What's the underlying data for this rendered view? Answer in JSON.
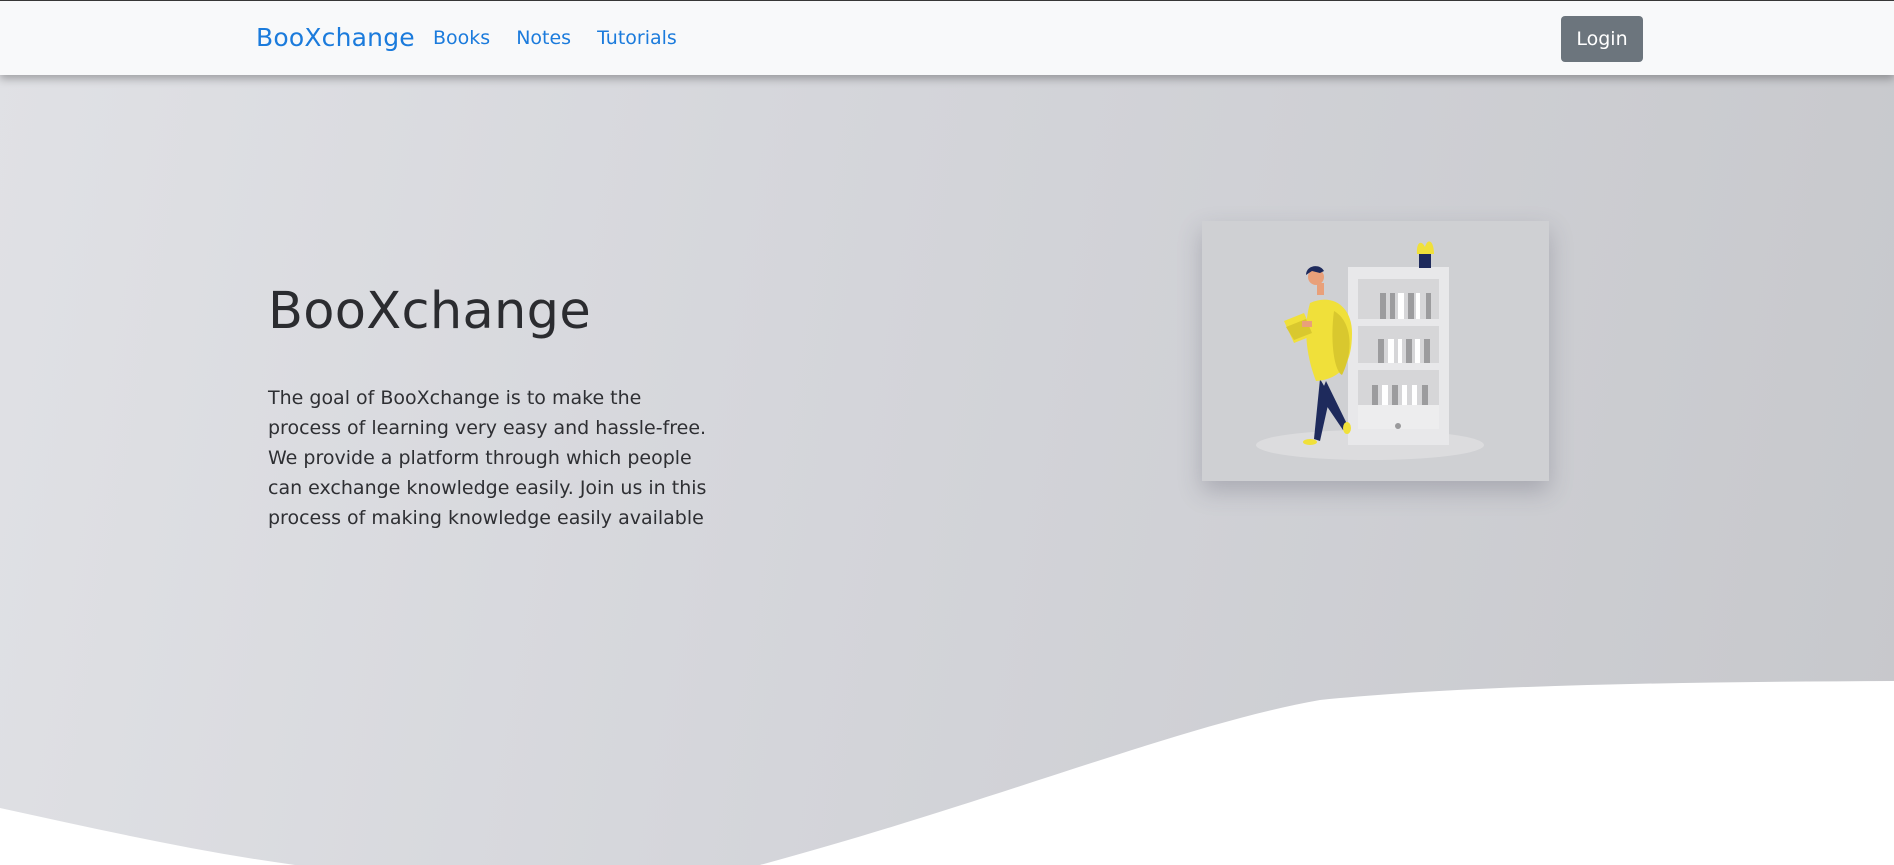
{
  "navbar": {
    "brand": "BooXchange",
    "links": [
      "Books",
      "Notes",
      "Tutorials"
    ],
    "login_label": "Login"
  },
  "hero": {
    "title": "BooXchange",
    "description": "The goal of BooXchange is to make the process of learning very easy and hassle-free. We provide a platform through which people can exchange knowledge easily. Join us in this process of making knowledge easily available",
    "illustration": "person-reading-by-bookshelf-illustration"
  },
  "colors": {
    "brand": "#1b7bdc",
    "login_button": "#6c757d",
    "navbar_bg": "#f8f9fa",
    "accent_yellow": "#f0e03a",
    "accent_navy": "#1e2a5c"
  }
}
